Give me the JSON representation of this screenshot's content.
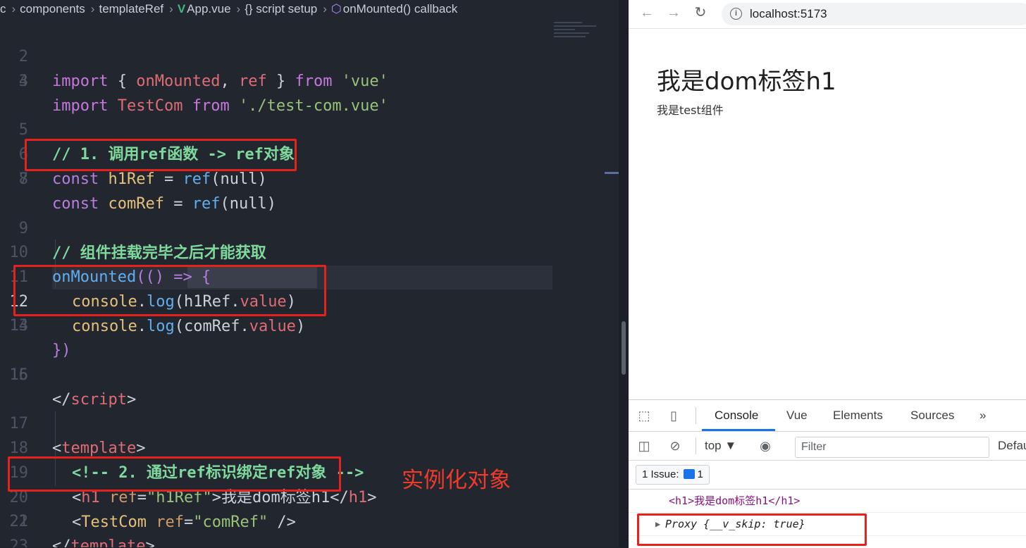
{
  "editor": {
    "breadcrumb": [
      "c",
      "components",
      "templateRef",
      "App.vue",
      "{} script setup",
      "onMounted() callback"
    ],
    "line_numbers": [
      "2",
      "3",
      "4",
      "5",
      "6",
      "7",
      "8",
      "9",
      "10",
      "11",
      "12",
      "13",
      "14",
      "15",
      "16",
      "17",
      "18",
      "19",
      "20",
      "21",
      "22",
      "23"
    ],
    "lines": {
      "l2": {
        "kw1": "import",
        "p1": " { ",
        "n1": "onMounted",
        "p2": ", ",
        "n2": "ref",
        "p3": " } ",
        "kw2": "from",
        "sp": " ",
        "s": "'vue'"
      },
      "l3": {
        "kw1": "import",
        "sp1": " ",
        "n": "TestCom",
        "sp2": " ",
        "kw2": "from",
        "sp3": " ",
        "s": "'./test-com.vue'"
      },
      "l5": {
        "c": "// 1. 调用ref函数 -> ref对象"
      },
      "l6": {
        "kw": "const",
        "sp": " ",
        "v": "h1Ref",
        "eq": " = ",
        "f": "ref",
        "a": "(null)"
      },
      "l7": {
        "kw": "const",
        "sp": " ",
        "v": "comRef",
        "eq": " = ",
        "f": "ref",
        "a": "(null)"
      },
      "l9": {
        "c": "// 组件挂载完毕之后才能获取"
      },
      "l10": {
        "f": "onMounted",
        "a": "(() => {"
      },
      "l11": {
        "o": "console",
        "d": ".",
        "f": "log",
        "p1": "(",
        "v": "h1Ref",
        "d2": ".",
        "pr": "value",
        "p2": ")"
      },
      "l12": {
        "o": "console",
        "d": ".",
        "f": "log",
        "p1": "(",
        "v": "comRef",
        "d2": ".",
        "pr": "value",
        "p2": ")"
      },
      "l13": {
        "t": "})"
      },
      "l15": {
        "t1": "</",
        "tag": "script",
        "t2": ">"
      },
      "l17": {
        "t1": "<",
        "tag": "template",
        "t2": ">"
      },
      "l18": {
        "c": "<!-- 2. 通过ref标识绑定ref对象 -->"
      },
      "l19": {
        "t1": "<",
        "tag": "h1",
        "sp": " ",
        "attr": "ref",
        "eq": "=",
        "s": "\"h1Ref\"",
        "t2": ">",
        "text": "我是dom标签h1",
        "t3": "</",
        "tag2": "h1",
        "t4": ">"
      },
      "l20": {
        "t1": "<",
        "tag": "TestCom",
        "sp": " ",
        "attr": "ref",
        "eq": "=",
        "s": "\"comRef\"",
        "t2": " />"
      },
      "l21": {
        "t1": "</",
        "tag": "template",
        "t2": ">"
      }
    },
    "annotation": "实例化对象"
  },
  "browser": {
    "url": "localhost:5173",
    "page_h1": "我是dom标签h1",
    "page_text": "我是test组件",
    "devtools": {
      "tabs": [
        "Console",
        "Vue",
        "Elements",
        "Sources",
        "»"
      ],
      "context": "top ▼",
      "filter_placeholder": "Filter",
      "levels": "Defau",
      "issues_label": "1 Issue:",
      "issues_count": "1",
      "log1": "<h1>我是dom标签h1</h1>",
      "log2": "Proxy {__v_skip: true}"
    }
  },
  "colors": {
    "highlight_box": "#e5231c",
    "active_tab": "#1a73e8"
  }
}
